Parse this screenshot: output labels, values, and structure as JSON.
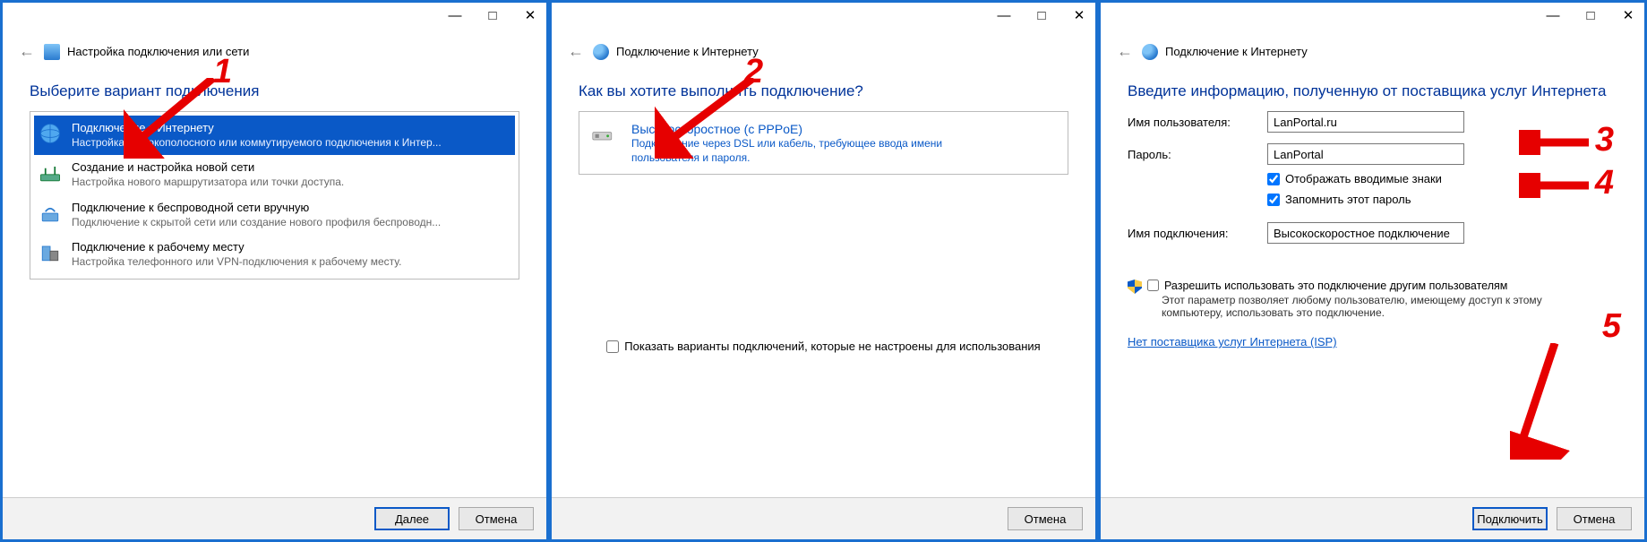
{
  "panel1": {
    "title": "Настройка подключения или сети",
    "heading": "Выберите вариант подключения",
    "options": [
      {
        "title": "Подключение к Интернету",
        "sub": "Настройка широкополосного или коммутируемого подключения к Интер..."
      },
      {
        "title": "Создание и настройка новой сети",
        "sub": "Настройка нового маршрутизатора или точки доступа."
      },
      {
        "title": "Подключение к беспроводной сети вручную",
        "sub": "Подключение к скрытой сети или создание нового профиля беспроводн..."
      },
      {
        "title": "Подключение к рабочему месту",
        "sub": "Настройка телефонного или VPN-подключения к рабочему месту."
      }
    ],
    "next": "Далее",
    "cancel": "Отмена"
  },
  "panel2": {
    "title": "Подключение к Интернету",
    "heading": "Как вы хотите выполнить подключение?",
    "option": {
      "title": "Высокоскоростное (с PPPoE)",
      "sub": "Подключение через DSL или кабель, требующее ввода имени пользователя и пароля."
    },
    "show_unconfigured": "Показать варианты подключений, которые не настроены для использования",
    "cancel": "Отмена"
  },
  "panel3": {
    "title": "Подключение к Интернету",
    "heading": "Введите информацию, полученную от поставщика услуг Интернета",
    "labels": {
      "username": "Имя пользователя:",
      "password": "Пароль:",
      "connname": "Имя подключения:"
    },
    "values": {
      "username": "LanPortal.ru",
      "password": "LanPortal",
      "connname": "Высокоскоростное подключение"
    },
    "show_chars": "Отображать вводимые знаки",
    "remember": "Запомнить этот пароль",
    "permit": "Разрешить использовать это подключение другим пользователям",
    "permit_desc": "Этот параметр позволяет любому пользователю, имеющему доступ к этому компьютеру, использовать это подключение.",
    "no_isp": "Нет поставщика услуг Интернета (ISP)",
    "connect": "Подключить",
    "cancel": "Отмена"
  },
  "badges": {
    "b1": "1",
    "b2": "2",
    "b3": "3",
    "b4": "4",
    "b5": "5"
  }
}
